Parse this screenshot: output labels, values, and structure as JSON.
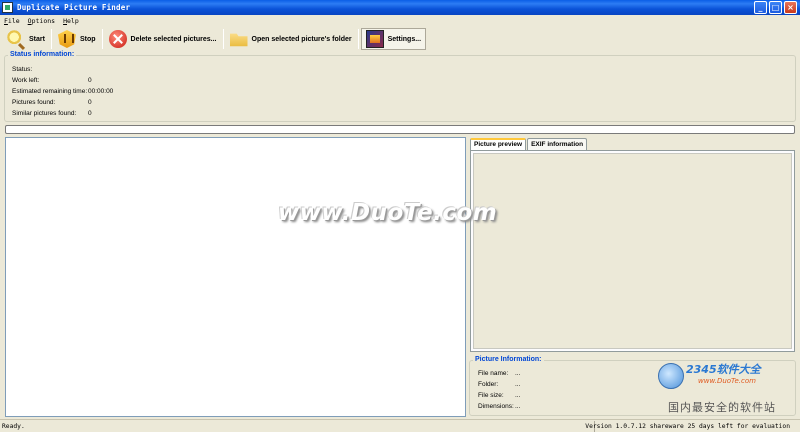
{
  "window": {
    "title": "Duplicate Picture Finder"
  },
  "menu": [
    {
      "label": "File"
    },
    {
      "label": "Options"
    },
    {
      "label": "Help"
    }
  ],
  "toolbar": {
    "start": "Start",
    "stop": "Stop",
    "delete": "Delete selected pictures...",
    "open_folder": "Open selected picture's folder",
    "settings": "Settings..."
  },
  "status": {
    "title": "Status information:",
    "status_label": "Status:",
    "status_value": "",
    "work_left_label": "Work left:",
    "work_left_value": "0",
    "remaining_label": "Estimated remaining time:",
    "remaining_value": "00:00:00",
    "pictures_found_label": "Pictures found:",
    "pictures_found_value": "0",
    "similar_label": "Similar pictures found:",
    "similar_value": "0"
  },
  "progress": {
    "value": 0
  },
  "tabs": [
    {
      "label": "Picture preview",
      "active": true
    },
    {
      "label": "EXIF information",
      "active": false
    }
  ],
  "picture_info": {
    "title": "Picture Information:",
    "file_name_label": "File name:",
    "file_name_value": "...",
    "folder_label": "Folder:",
    "folder_value": "...",
    "file_size_label": "File size:",
    "file_size_value": "...",
    "dimensions_label": "Dimensions:",
    "dimensions_value": "..."
  },
  "statusbar": {
    "left": "Ready.",
    "right": "Version 1.0.7.12 shareware 25 days left for evaluation"
  },
  "watermark": {
    "site": "www.DuoTe.com",
    "logo_text": "2345软件大全",
    "logo_url": "www.DuoTe.com",
    "tagline": "国内最安全的软件站"
  }
}
